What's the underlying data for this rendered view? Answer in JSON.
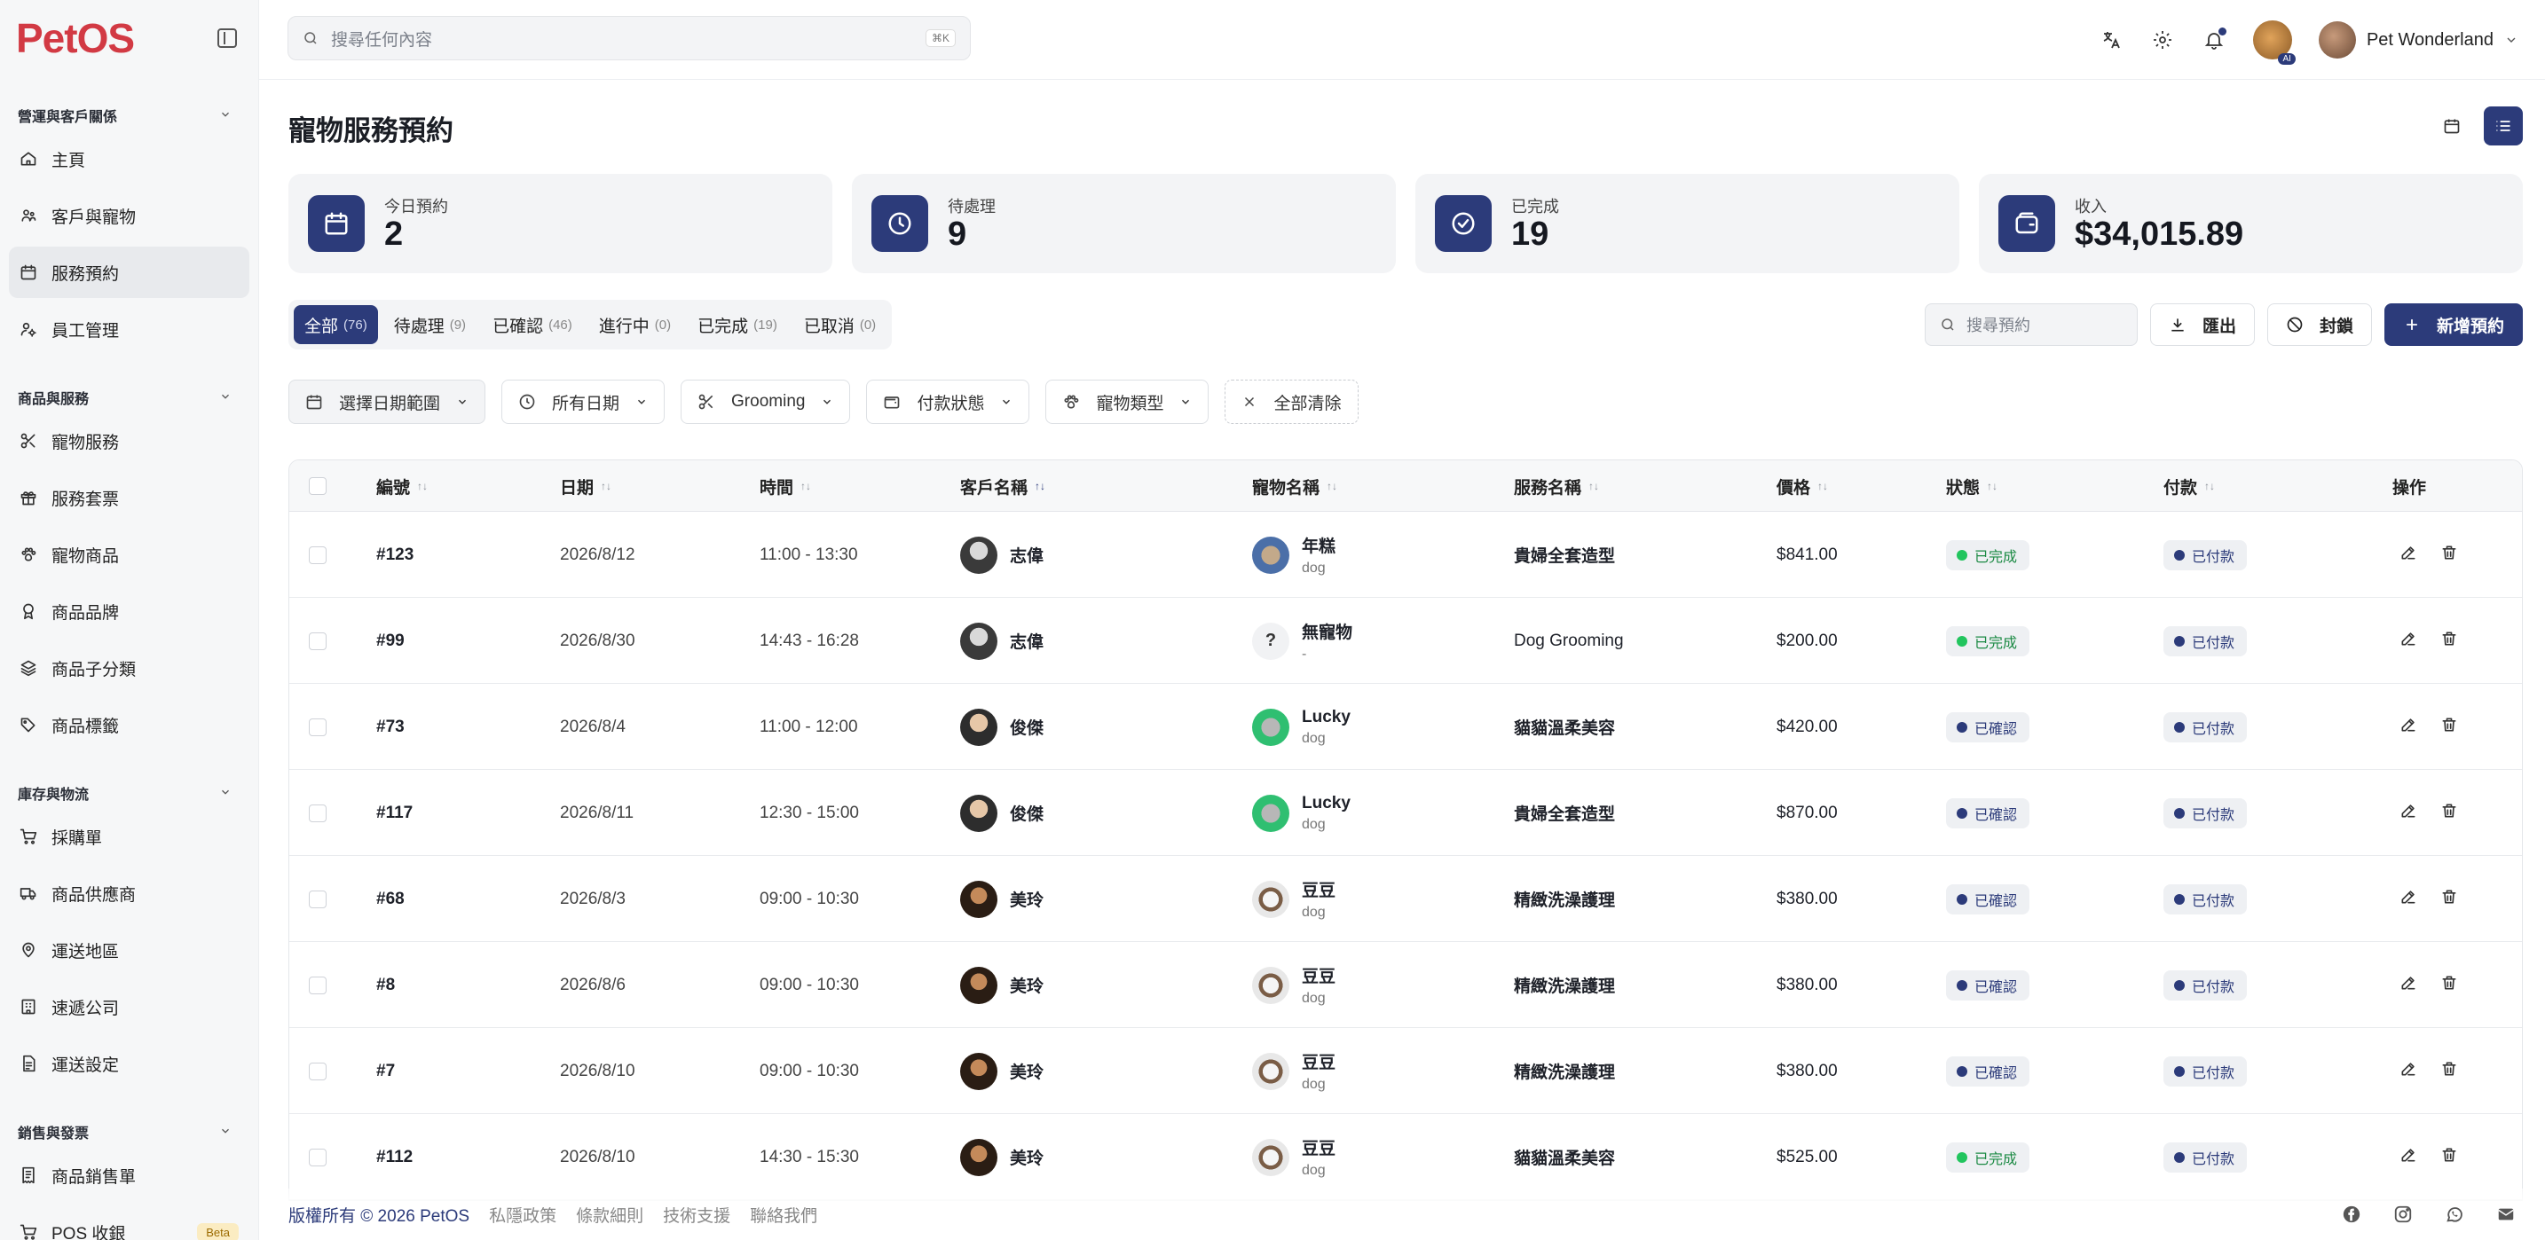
{
  "app": {
    "logo_text": "PetOS",
    "search_placeholder": "搜尋任何內容",
    "search_kbd": "⌘K",
    "user_name": "Pet Wonderland",
    "ai_badge": "AI"
  },
  "sidebar": {
    "sections": [
      {
        "title": "營運與客戶關係",
        "items": [
          {
            "label": "主頁",
            "icon": "home-icon"
          },
          {
            "label": "客戶與寵物",
            "icon": "paw-users-icon"
          },
          {
            "label": "服務預約",
            "icon": "calendar-icon",
            "active": true
          },
          {
            "label": "員工管理",
            "icon": "user-cog-icon"
          }
        ]
      },
      {
        "title": "商品與服務",
        "items": [
          {
            "label": "寵物服務",
            "icon": "scissors-icon"
          },
          {
            "label": "服務套票",
            "icon": "gift-icon"
          },
          {
            "label": "寵物商品",
            "icon": "paw-icon"
          },
          {
            "label": "商品品牌",
            "icon": "award-icon"
          },
          {
            "label": "商品子分類",
            "icon": "layers-icon"
          },
          {
            "label": "商品標籤",
            "icon": "tags-icon"
          }
        ]
      },
      {
        "title": "庫存與物流",
        "items": [
          {
            "label": "採購單",
            "icon": "cart-icon"
          },
          {
            "label": "商品供應商",
            "icon": "truck-icon"
          },
          {
            "label": "運送地區",
            "icon": "map-pin-icon"
          },
          {
            "label": "速遞公司",
            "icon": "building-icon"
          },
          {
            "label": "運送設定",
            "icon": "file-settings-icon"
          }
        ]
      },
      {
        "title": "銷售與發票",
        "items": [
          {
            "label": "商品銷售單",
            "icon": "receipt-icon"
          },
          {
            "label": "POS 收銀",
            "icon": "pos-cart-icon",
            "badge": "Beta"
          }
        ]
      }
    ]
  },
  "page": {
    "title": "寵物服務預約"
  },
  "stats": [
    {
      "label": "今日預約",
      "value": "2",
      "icon": "calendar-icon"
    },
    {
      "label": "待處理",
      "value": "9",
      "icon": "clock-icon"
    },
    {
      "label": "已完成",
      "value": "19",
      "icon": "check-circle-icon"
    },
    {
      "label": "收入",
      "value": "$34,015.89",
      "icon": "wallet-icon"
    }
  ],
  "tabs": [
    {
      "label": "全部",
      "count": "(76)",
      "active": true
    },
    {
      "label": "待處理",
      "count": "(9)"
    },
    {
      "label": "已確認",
      "count": "(46)"
    },
    {
      "label": "進行中",
      "count": "(0)"
    },
    {
      "label": "已完成",
      "count": "(19)"
    },
    {
      "label": "已取消",
      "count": "(0)"
    }
  ],
  "actions": {
    "search_placeholder": "搜尋預約",
    "export": "匯出",
    "block": "封鎖",
    "new": "新增預約"
  },
  "filters": {
    "date_range": "選擇日期範圍",
    "all_dates": "所有日期",
    "service": "Grooming",
    "payment_status": "付款狀態",
    "pet_type": "寵物類型",
    "clear_all": "全部清除"
  },
  "table": {
    "headers": {
      "id": "編號",
      "date": "日期",
      "time": "時間",
      "customer": "客戶名稱",
      "pet": "寵物名稱",
      "service": "服務名稱",
      "price": "價格",
      "status": "狀態",
      "payment": "付款",
      "ops": "操作"
    },
    "rows": [
      {
        "id": "#123",
        "date": "2026/8/12",
        "time": "11:00 - 13:30",
        "customer": "志偉",
        "cust_av": "av-p1",
        "pet": "年糕",
        "pet_type": "dog",
        "pet_av": "av-dog",
        "service": "貴婦全套造型",
        "service_bold": true,
        "price": "$841.00",
        "status": "已完成",
        "status_kind": "done",
        "payment": "已付款"
      },
      {
        "id": "#99",
        "date": "2026/8/30",
        "time": "14:43 - 16:28",
        "customer": "志偉",
        "cust_av": "av-p1",
        "pet": "無寵物",
        "pet_type": "-",
        "pet_av": "av-q",
        "service": "Dog Grooming",
        "service_bold": false,
        "price": "$200.00",
        "status": "已完成",
        "status_kind": "done",
        "payment": "已付款"
      },
      {
        "id": "#73",
        "date": "2026/8/4",
        "time": "11:00 - 12:00",
        "customer": "俊傑",
        "cust_av": "av-p2",
        "pet": "Lucky",
        "pet_type": "dog",
        "pet_av": "av-cat",
        "service": "貓貓溫柔美容",
        "service_bold": true,
        "price": "$420.00",
        "status": "已確認",
        "status_kind": "confirmed",
        "payment": "已付款"
      },
      {
        "id": "#117",
        "date": "2026/8/11",
        "time": "12:30 - 15:00",
        "customer": "俊傑",
        "cust_av": "av-p2",
        "pet": "Lucky",
        "pet_type": "dog",
        "pet_av": "av-cat",
        "service": "貴婦全套造型",
        "service_bold": true,
        "price": "$870.00",
        "status": "已確認",
        "status_kind": "confirmed",
        "payment": "已付款"
      },
      {
        "id": "#68",
        "date": "2026/8/3",
        "time": "09:00 - 10:30",
        "customer": "美玲",
        "cust_av": "av-p3",
        "pet": "豆豆",
        "pet_type": "dog",
        "pet_av": "av-pup",
        "service": "精緻洗澡護理",
        "service_bold": true,
        "price": "$380.00",
        "status": "已確認",
        "status_kind": "confirmed",
        "payment": "已付款"
      },
      {
        "id": "#8",
        "date": "2026/8/6",
        "time": "09:00 - 10:30",
        "customer": "美玲",
        "cust_av": "av-p3",
        "pet": "豆豆",
        "pet_type": "dog",
        "pet_av": "av-pup",
        "service": "精緻洗澡護理",
        "service_bold": true,
        "price": "$380.00",
        "status": "已確認",
        "status_kind": "confirmed",
        "payment": "已付款"
      },
      {
        "id": "#7",
        "date": "2026/8/10",
        "time": "09:00 - 10:30",
        "customer": "美玲",
        "cust_av": "av-p3",
        "pet": "豆豆",
        "pet_type": "dog",
        "pet_av": "av-pup",
        "service": "精緻洗澡護理",
        "service_bold": true,
        "price": "$380.00",
        "status": "已確認",
        "status_kind": "confirmed",
        "payment": "已付款"
      },
      {
        "id": "#112",
        "date": "2026/8/10",
        "time": "14:30 - 15:30",
        "customer": "美玲",
        "cust_av": "av-p3",
        "pet": "豆豆",
        "pet_type": "dog",
        "pet_av": "av-pup",
        "service": "貓貓溫柔美容",
        "service_bold": true,
        "price": "$525.00",
        "status": "已完成",
        "status_kind": "done",
        "payment": "已付款"
      }
    ]
  },
  "footer": {
    "copyright": "版權所有 © 2026 PetOS",
    "links": [
      "私隱政策",
      "條款細則",
      "技術支援",
      "聯絡我們"
    ],
    "socials": [
      "facebook-icon",
      "instagram-icon",
      "whatsapp-icon",
      "mail-icon"
    ]
  },
  "colors": {
    "primary": "#2c3b7a",
    "brand_red": "#d23a44",
    "done_green": "#22c55e"
  }
}
